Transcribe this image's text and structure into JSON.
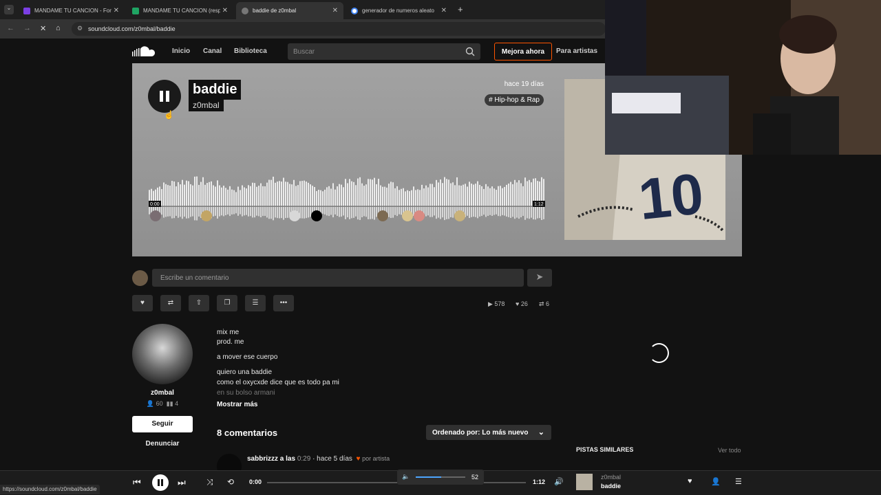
{
  "browser": {
    "tabs": [
      {
        "label": "MANDAME TU CANCION - For",
        "icon": "forms-icon",
        "color": "#7b3fe4"
      },
      {
        "label": "MANDAME TU CANCION (resp",
        "icon": "sheets-icon",
        "color": "#1fa463"
      },
      {
        "label": "baddie de z0mbal",
        "icon": "soundcloud-icon",
        "color": "#888888"
      },
      {
        "label": "generador de numeros aleato",
        "icon": "google-icon",
        "color": "#4285f4"
      }
    ],
    "url": "soundcloud.com/z0mbal/baddie"
  },
  "header": {
    "nav": [
      "Inicio",
      "Canal",
      "Biblioteca"
    ],
    "search_placeholder": "Buscar",
    "upgrade_label": "Mejora ahora",
    "artists_label": "Para artistas"
  },
  "track": {
    "title": "baddie",
    "artist": "z0mbal",
    "posted": "hace 19 días",
    "genre": "# Hip-hop & Rap",
    "time_start": "0:00",
    "time_end": "1:12"
  },
  "comment_box": {
    "placeholder": "Escribe un comentario"
  },
  "stats": {
    "plays": "578",
    "likes": "26",
    "reposts": "6"
  },
  "artist_panel": {
    "name": "z0mbal",
    "followers": "60",
    "tracks": "4",
    "follow_label": "Seguir",
    "report_label": "Denunciar"
  },
  "description": {
    "lines": [
      "mix me",
      "prod. me",
      "a mover ese cuerpo",
      "quiero una baddie",
      "como el oxycxde dice que es todo pa mi",
      "en su bolso armani"
    ],
    "show_more": "Mostrar más"
  },
  "comments": {
    "count_label": "8 comentarios",
    "sort_label": "Ordenado por: Lo más nuevo",
    "first": {
      "user": "sabbrizzz",
      "at_label": "a las",
      "time": "0:29",
      "ago": "· hace 5 días",
      "artist_badge": "por artista"
    }
  },
  "sidebar": {
    "similar_label": "PISTAS SIMILARES",
    "see_all": "Ver todo"
  },
  "player": {
    "current": "0:00",
    "duration": "1:12",
    "volume": "52",
    "artist": "z0mbal",
    "title": "baddie"
  },
  "status_url": "https://soundcloud.com/z0mbal/baddie",
  "colors": {
    "accent": "#ff5500",
    "bg": "#121212"
  }
}
